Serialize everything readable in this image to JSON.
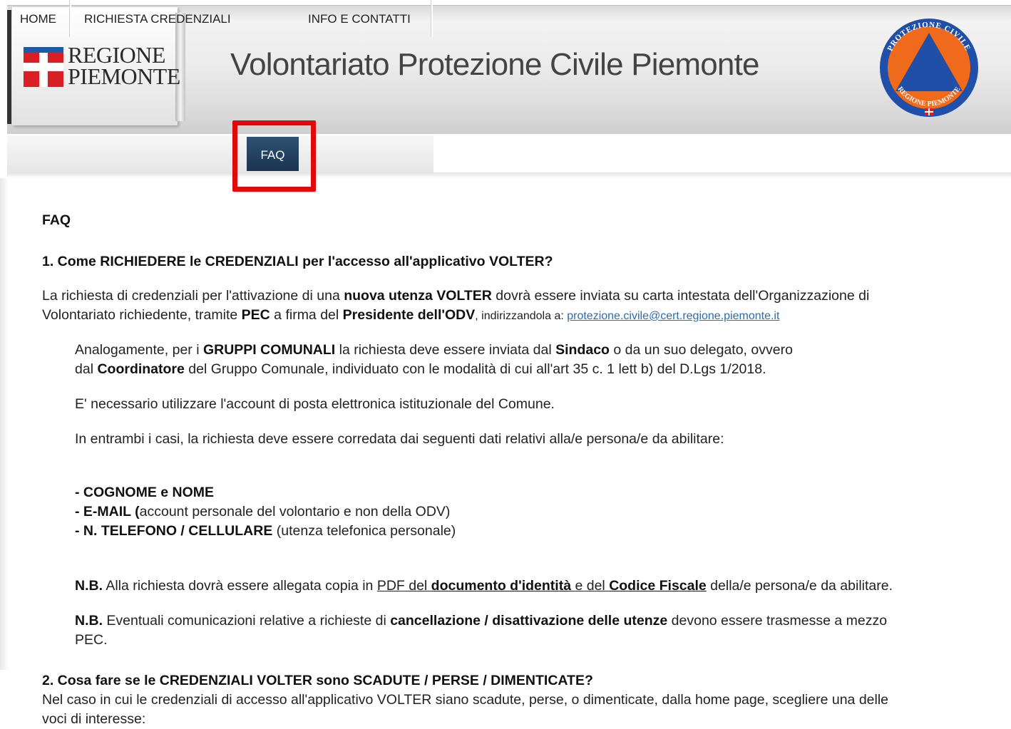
{
  "header": {
    "region_line1": "REGIONE",
    "region_line2": "PIEMONTE",
    "site_title": "Volontariato Protezione Civile Piemonte",
    "emblem_icon": "protezione-civile-emblem-icon"
  },
  "nav": {
    "items": [
      "HOME",
      "RICHIESTA CREDENZIALI",
      "FAQ",
      "INFO E CONTATTI"
    ],
    "active": "FAQ",
    "active_color": "#1f3d5c",
    "highlight_color": "#e10a0a"
  },
  "faq": {
    "title": "FAQ",
    "q1": {
      "question": "1. Come RICHIEDERE le CREDENZIALI per l'accesso all'applicativo VOLTER?",
      "p1_a": "La richiesta di credenziali per l'attivazione di una ",
      "p1_b": "nuova utenza VOLTER",
      "p1_c": " dovrà essere inviata su carta intestata dell'Organizzazione di",
      "p1_d": "Volontariato richiedente, tramite ",
      "p1_e": "PEC",
      "p1_f": " a firma del ",
      "p1_g": "Presidente dell'ODV",
      "p1_h": ", indirizzandola a: ",
      "p1_link": "protezione.civile@cert.regione.piemonte.it",
      "p2_a": "Analogamente, per i ",
      "p2_b": "GRUPPI COMUNALI",
      "p2_c": " la richiesta deve essere inviata dal ",
      "p2_d": "Sindaco",
      "p2_e": " o da un suo delegato, ovvero",
      "p2_f": "dal ",
      "p2_g": "Coordinatore",
      "p2_h": " del Gruppo Comunale, individuato con le modalità di cui all'art 35 c. 1 lett b) del D.Lgs 1/2018.",
      "p3": "E' necessario utilizzare l'account di posta elettronica istituzionale del Comune.",
      "p4": "In entrambi i casi, la richiesta deve essere corredata dai seguenti dati relativi alla/e persona/e da abilitare:",
      "list": [
        {
          "bold": "- COGNOME e NOME",
          "rest": ""
        },
        {
          "bold": "- E-MAIL (",
          "rest": "account personale del volontario e non della ODV)"
        },
        {
          "bold": "- N. TELEFONO / CELLULARE",
          "rest": " (utenza telefonica personale)"
        }
      ],
      "nb1_a": "N.B.",
      "nb1_b": " Alla richiesta dovrà essere allegata copia in ",
      "nb1_c": "PDF",
      "nb1_d": " del ",
      "nb1_e": "documento d'identità",
      "nb1_f": " e del ",
      "nb1_g": "Codice Fiscale",
      "nb1_h": " della/e persona/e da abilitare.",
      "nb2_a": "N.B.",
      "nb2_b": " Eventuali comunicazioni relative a richieste di ",
      "nb2_c": "cancellazione / disattivazione delle utenze",
      "nb2_d": " devono essere trasmesse a mezzo",
      "nb2_e": "PEC."
    },
    "q2": {
      "question": "2. Cosa fare se le CREDENZIALI VOLTER sono SCADUTE / PERSE / DIMENTICATE?",
      "answer_line1": "Nel caso in cui le credenziali di accesso all'applicativo VOLTER siano scadute, perse, o dimenticate, dalla home page, scegliere una delle",
      "answer_line2": "voci di interesse:"
    }
  }
}
